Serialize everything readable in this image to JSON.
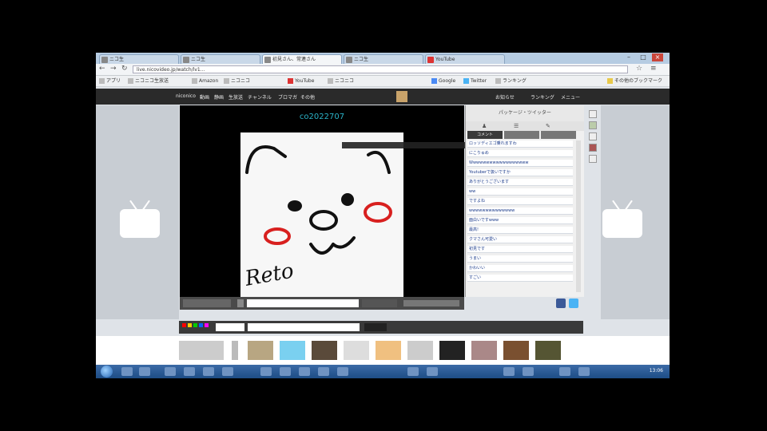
{
  "browser": {
    "tabs": [
      {
        "label": "ニコ生"
      },
      {
        "label": "ニコ生"
      },
      {
        "label": "初見さん、常連さん"
      },
      {
        "label": "ニコ生"
      },
      {
        "label": "YouTube"
      }
    ],
    "url": "live.nicovideo.jp/watch/lv1...",
    "bookmarks": [
      "アプリ",
      "ニコニコ生放送",
      "Amazon",
      "ニコニコ",
      "YouTube",
      "ニコニコ",
      "Google",
      "Twitter",
      "ランキング",
      "その他のブックマーク"
    ]
  },
  "nico": {
    "nav": [
      "niconico",
      "動画",
      "静画",
      "生放送",
      "チャンネル",
      "ブロマガ",
      "その他"
    ],
    "user": [
      "お知らせ",
      "ランキング",
      "メニュー"
    ],
    "community_id": "co2022707"
  },
  "comments": {
    "header": "パッケージ・ツイッター",
    "tabs": [
      "コメント",
      "",
      ""
    ],
    "rows": [
      "ロッソディエゴ乗れますわ",
      "にこりゅめ",
      "Wwwwwwwwwwwwwwwwww",
      "Youtuberで扱いですか",
      "ありがとうございます",
      "ww",
      "ですよね",
      "wwwwwwwwwwwwww",
      "面白いですwww",
      "最高!",
      "クマさん可愛い",
      "初見です",
      "うまい",
      "かわいい",
      "すごい"
    ]
  },
  "drawing": {
    "signature": "Reto"
  },
  "taskbar": {
    "clock": "13:06"
  }
}
